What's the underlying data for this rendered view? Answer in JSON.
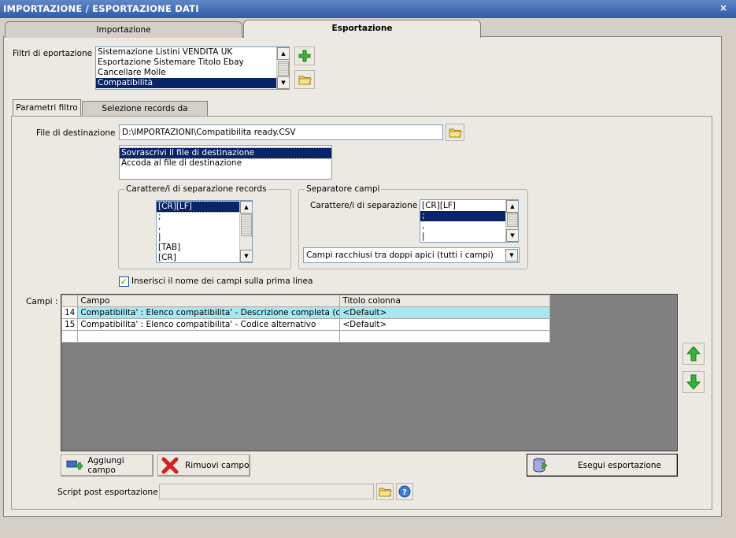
{
  "window": {
    "title": "IMPORTAZIONE / ESPORTAZIONE DATI",
    "close_glyph": "×"
  },
  "tabs": [
    {
      "label": "Importazione"
    },
    {
      "label": "Esportazione"
    }
  ],
  "filters": {
    "label": "Filtri di eportazione :",
    "items": [
      "Sistemazione Listini VENDITA UK",
      "Esportazione Sistemare Titolo Ebay",
      "Cancellare Molle",
      "Compatibilità"
    ]
  },
  "subtabs": [
    {
      "label": "Parametri filtro"
    },
    {
      "label": "Selezione records da esportare"
    }
  ],
  "destination": {
    "label": "File di destinazione :",
    "value": "D:\\IMPORTAZIONI\\Compatibilita ready.CSV",
    "modes": [
      "Sovrascrivi il file di destinazione",
      "Accoda al file di destinazione"
    ]
  },
  "record_separator": {
    "title": "Carattere/i di separazione records",
    "items": [
      "[CR][LF]",
      ";",
      ",",
      "|",
      "[TAB]",
      "[CR]"
    ]
  },
  "field_separator": {
    "title": "Separatore campi",
    "label": "Carattere/i di separazione :",
    "items": [
      "[CR][LF]",
      ";",
      ",",
      "|"
    ],
    "quote_option": "Campi racchiusi tra doppi apici (tutti i campi)"
  },
  "header_checkbox": {
    "label": "Inserisci il nome dei campi sulla prima linea",
    "checked": true,
    "glyph": "✓"
  },
  "fields_grid": {
    "label": "Campi :",
    "columns": [
      "Campo",
      "Titolo colonna"
    ],
    "rows": [
      {
        "n": "14",
        "campo": "Compatibilita' : Elenco compatibilita' - Descrizione completa (compr...",
        "titolo": "<Default>"
      },
      {
        "n": "15",
        "campo": "Compatibilita' : Elenco compatibilita' - Codice alternativo",
        "titolo": "<Default>"
      }
    ]
  },
  "buttons": {
    "add_field": "Aggiungi campo",
    "remove_field": "Rimuovi campo",
    "run_export": "Esegui esportazione"
  },
  "script": {
    "label": "Script post esportazione :",
    "value": ""
  },
  "colors": {
    "title_bar": "#2f5ba8",
    "selection": "#0a246a",
    "row_highlight": "#a6e8f0",
    "grid_bg": "#808080"
  }
}
